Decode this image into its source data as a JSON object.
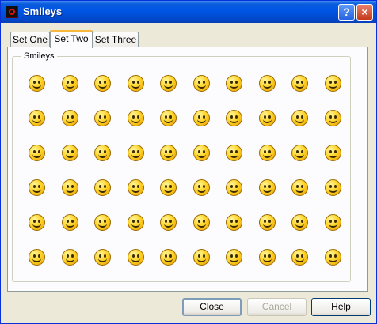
{
  "window": {
    "title": "Smileys"
  },
  "tabs": [
    {
      "label": "Set One",
      "active": false
    },
    {
      "label": "Set Two",
      "active": true
    },
    {
      "label": "Set Three",
      "active": false
    }
  ],
  "group": {
    "label": "Smileys"
  },
  "smileys": [
    "afro-smiley-icon",
    "alien-smiley-icon",
    "turban-smiley-icon",
    "balloon-smiley-icon",
    "bandana-smiley-icon",
    "sailboat-smiley-icon",
    "cigarette-smiley-icon",
    "sleepy-smiley-icon",
    "dizzy-smiley-icon",
    "pirate-smiley-icon",
    "wolf-smiley-icon",
    "beer-smiley-icon",
    "chef-smiley-icon",
    "coolie-hat-smiley-icon",
    "grin-smiley-icon",
    "sly-smiley-icon",
    "worried-smiley-icon",
    "cowboy-smiley-icon",
    "detective-smiley-icon",
    "devil-smiley-icon",
    "smirk-smiley-icon",
    "hatched-chick-smiley-icon",
    "shocked-smiley-icon",
    "drinking-smiley-icon",
    "top-hat-smiley-icon",
    "flushed-smiley-icon",
    "angry-smiley-icon",
    "jester-smiley-icon",
    "flag-smiley-icon",
    "party-hat-smiley-icon",
    "idea-smiley-icon",
    "harlequin-smiley-icon",
    "bandana-smiley-icon",
    "teddy-smiley-icon",
    "crown-smiley-icon",
    "kiss-smiley-icon",
    "glasses-smiley-icon",
    "blush-smiley-icon",
    "native-feather-smiley-icon",
    "dead-smiley-icon",
    "crying-bandana-smiley-icon",
    "mad-smiley-icon",
    "pirate-smiley-icon",
    "chief-headdress-smiley-icon",
    "sick-smiley-icon",
    "sailor-smiley-icon",
    "laugh-smiley-icon",
    "ninja-smiley-icon",
    "wizard-smiley-icon",
    "grimace-smiley-icon",
    "wink-bruise-smiley-icon",
    "taz-smiley-icon",
    "sleepy-smiley-icon",
    "headphones-smiley-icon",
    "ruler-smiley-icon",
    "music-smiley-icon",
    "blank-smiley-icon",
    "pirate-gun-smiley-icon",
    "batman-smiley-icon",
    "santa-smiley-icon"
  ],
  "buttons": {
    "close": "Close",
    "cancel": "Cancel",
    "help": "Help"
  },
  "colors": {
    "titlebar": "#0055e5",
    "tab_highlight": "#f6b83d",
    "face": "#ffd52a"
  }
}
